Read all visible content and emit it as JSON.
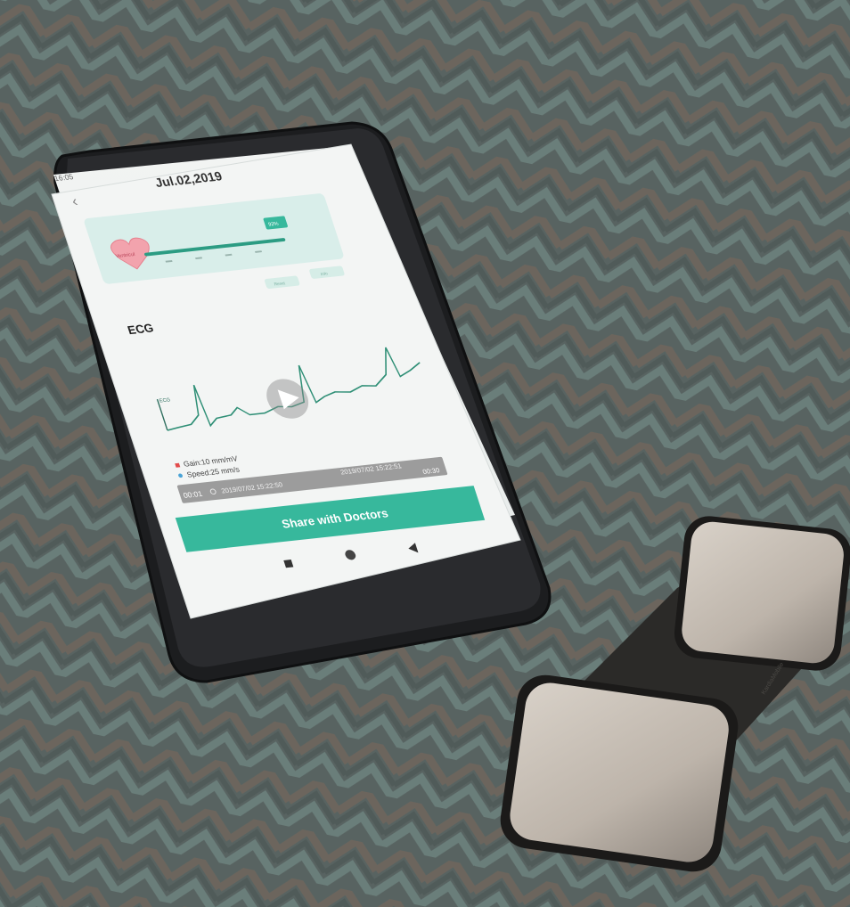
{
  "photo": {
    "fabric_colors": {
      "base": "#5f6a68",
      "teal": "#6f8f8a",
      "brown": "#8a6f5e"
    },
    "phone": {
      "status_time": "16:05",
      "date_title": "Jul.02,2019",
      "back_icon": "chevron-left-icon",
      "heart_rate_label": "Ventricul",
      "bar_badge": "92%",
      "mini_buttons": [
        "Reset",
        "Info"
      ],
      "ecg_heading": "ECG",
      "trace_label": "ECG",
      "legend": {
        "gain": "Gain:10 mm/mV",
        "speed": "Speed:25 mm/s",
        "gain_color": "#e24b4b",
        "speed_color": "#4aa3d6"
      },
      "timeline": {
        "left_time": "00:01",
        "start_timestamp": "2019/07/02 15:22:50",
        "end_timestamp": "2019/07/02 15:22:51",
        "end_time": "00:30"
      },
      "share_button": "Share with Doctors",
      "accent_color": "#37b89c",
      "nav_icons": [
        "square-icon",
        "circle-icon",
        "triangle-back-icon"
      ]
    },
    "device": {
      "brand_mark": "KardiaMobile"
    }
  }
}
